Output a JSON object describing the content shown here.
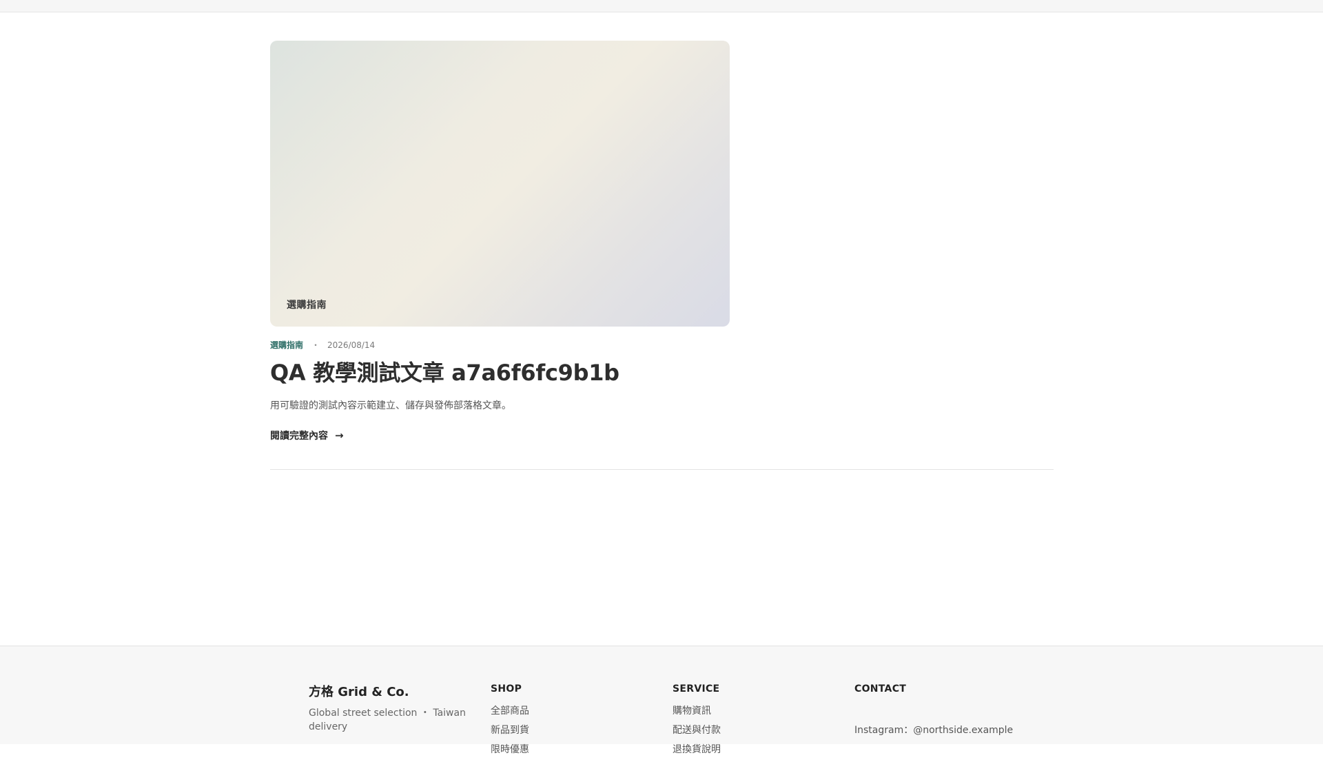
{
  "post": {
    "image_tag": "選購指南",
    "category": "選購指南",
    "separator": "・",
    "date": "2026/08/14",
    "title": "QA 教學測試文章 a7a6f6fc9b1b",
    "excerpt": "用可驗證的測試內容示範建立、儲存與發佈部落格文章。",
    "read_more": "閱讀完整內容",
    "read_more_arrow": "→"
  },
  "footer": {
    "brand": {
      "name": "方格 Grid & Co.",
      "tagline": "Global street selection ・ Taiwan delivery"
    },
    "shop": {
      "heading": "SHOP",
      "items": [
        "全部商品",
        "新品到貨",
        "限時優惠"
      ]
    },
    "service": {
      "heading": "SERVICE",
      "items": [
        "購物資訊",
        "配送與付款",
        "退換貨說明"
      ]
    },
    "contact": {
      "heading": "CONTACT",
      "instagram": "Instagram：@northside.example"
    }
  },
  "colors": {
    "accent": "#2f6f68",
    "footer_bg": "#f7f7f7"
  }
}
